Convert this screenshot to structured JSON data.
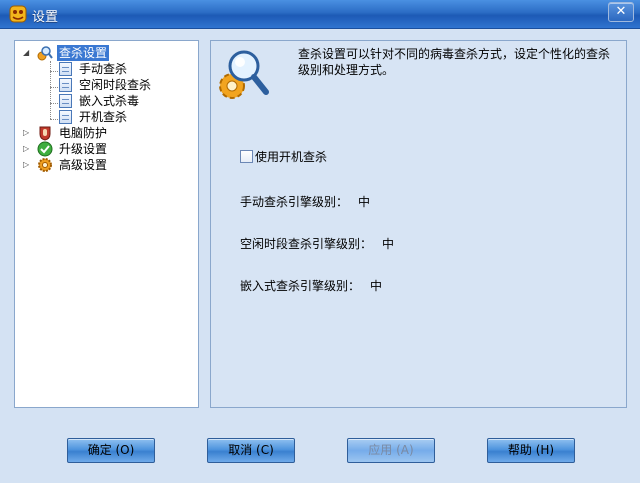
{
  "window": {
    "title": "设置",
    "close_symbol": "✕"
  },
  "tree": {
    "root": {
      "label": "查杀设置",
      "expander": "◢"
    },
    "children": [
      {
        "label": "手动查杀"
      },
      {
        "label": "空闲时段查杀"
      },
      {
        "label": "嵌入式杀毒"
      },
      {
        "label": "开机查杀"
      }
    ],
    "other_nodes": [
      {
        "label": "电脑防护",
        "expander": "▷",
        "icon": "shield-glove-icon"
      },
      {
        "label": "升级设置",
        "expander": "▷",
        "icon": "green-check-icon"
      },
      {
        "label": "高级设置",
        "expander": "▷",
        "icon": "gear-icon"
      }
    ]
  },
  "panel": {
    "description": "查杀设置可以针对不同的病毒查杀方式，设定个性化的查杀级别和处理方式。",
    "startup_scan_label": "使用开机查杀",
    "levels": [
      {
        "label": "手动查杀引擎级别：",
        "value": "中"
      },
      {
        "label": "空闲时段查杀引擎级别：",
        "value": "中"
      },
      {
        "label": "嵌入式查杀引擎级别：",
        "value": "中"
      }
    ]
  },
  "buttons": {
    "ok": "确定 (O)",
    "cancel": "取消 (C)",
    "apply": "应用 (A)",
    "help": "帮助 (H)"
  }
}
